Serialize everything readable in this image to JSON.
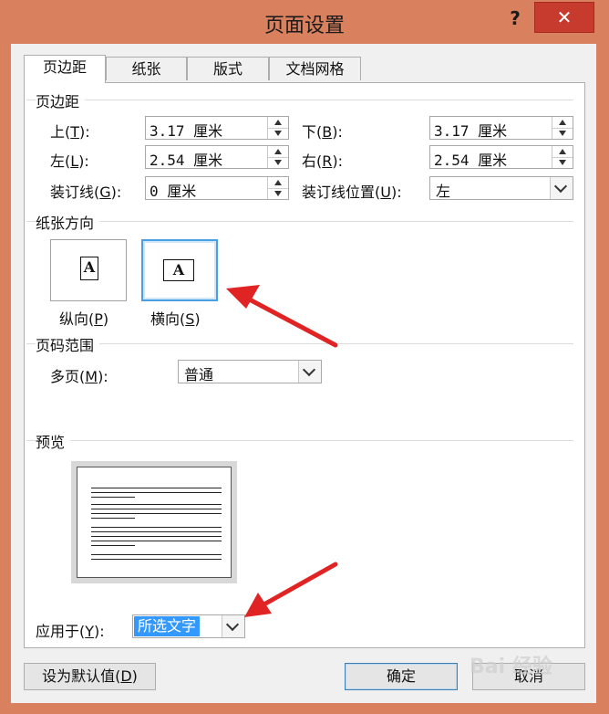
{
  "window": {
    "title": "页面设置",
    "help_label": "?",
    "close_label": "✕"
  },
  "tabs": [
    {
      "label": "页边距",
      "active": true
    },
    {
      "label": "纸张",
      "active": false
    },
    {
      "label": "版式",
      "active": false
    },
    {
      "label": "文档网格",
      "active": false
    }
  ],
  "margins": {
    "section_title": "页边距",
    "top": {
      "label": "上(",
      "key": "T",
      "suffix": "):",
      "value": "3.17 厘米"
    },
    "bottom": {
      "label": "下(",
      "key": "B",
      "suffix": "):",
      "value": "3.17 厘米"
    },
    "left": {
      "label": "左(",
      "key": "L",
      "suffix": "):",
      "value": "2.54 厘米"
    },
    "right": {
      "label": "右(",
      "key": "R",
      "suffix": "):",
      "value": "2.54 厘米"
    },
    "gutter": {
      "label": "装订线(",
      "key": "G",
      "suffix": "):",
      "value": "0 厘米"
    },
    "gutter_position": {
      "label": "装订线位置(",
      "key": "U",
      "suffix": "):",
      "value": "左"
    }
  },
  "orientation": {
    "section_title": "纸张方向",
    "portrait": {
      "label": "纵向(",
      "key": "P",
      "suffix": ")",
      "icon_letter": "A"
    },
    "landscape": {
      "label": "横向(",
      "key": "S",
      "suffix": ")",
      "icon_letter": "A"
    },
    "selected": "landscape"
  },
  "pages": {
    "section_title": "页码范围",
    "multiple": {
      "label": "多页(",
      "key": "M",
      "suffix": "):",
      "value": "普通"
    }
  },
  "preview": {
    "section_title": "预览"
  },
  "apply_to": {
    "label": "应用于(",
    "key": "Y",
    "suffix": "):",
    "value": "所选文字"
  },
  "buttons": {
    "set_default": {
      "label": "设为默认值(",
      "key": "D",
      "suffix": ")"
    },
    "ok": "确定",
    "cancel": "取消"
  },
  "watermark": "Bai 经验",
  "colors": {
    "title_bar": "#d9805f",
    "close_button": "#c73a2e",
    "annotation_arrow": "#e02424",
    "selection": "#3399ff",
    "selected_border": "#4a9fe0"
  }
}
